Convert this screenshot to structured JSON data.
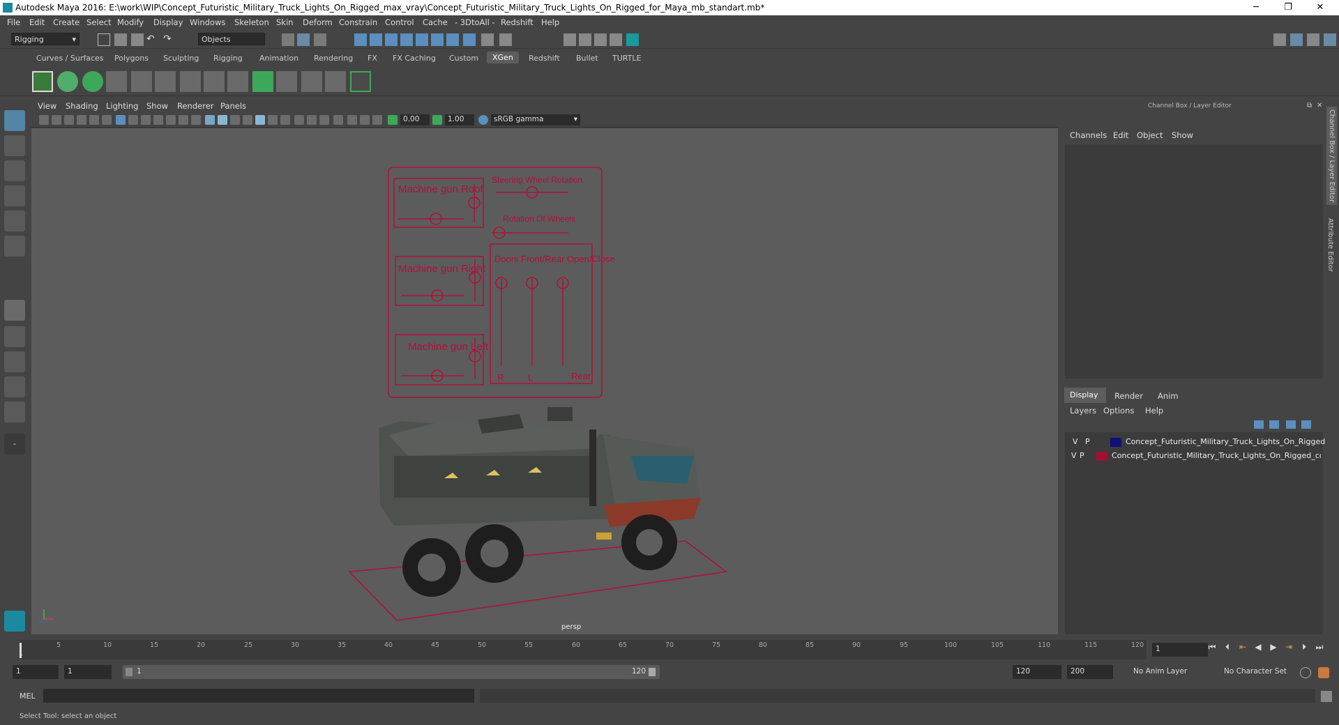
{
  "window": {
    "title": "Autodesk Maya 2016: E:\\work\\WIP\\Concept_Futuristic_Military_Truck_Lights_On_Rigged_max_vray\\Concept_Futuristic_Military_Truck_Lights_On_Rigged_for_Maya_mb_standart.mb*",
    "minimize": "─",
    "restore": "❐",
    "close": "✕"
  },
  "menubar": [
    "File",
    "Edit",
    "Create",
    "Select",
    "Modify",
    "Display",
    "Windows",
    "Skeleton",
    "Skin",
    "Deform",
    "Constrain",
    "Control",
    "Cache",
    "- 3DtoAll -",
    "Redshift",
    "Help"
  ],
  "statusline": {
    "mode": "Rigging",
    "selection_mask": "Objects"
  },
  "shelf_tabs": [
    "Curves / Surfaces",
    "Polygons",
    "Sculpting",
    "Rigging",
    "Animation",
    "Rendering",
    "FX",
    "FX Caching",
    "Custom",
    "XGen",
    "Redshift",
    "Bullet",
    "TURTLE"
  ],
  "shelf_active": "XGen",
  "viewport": {
    "menus": [
      "View",
      "Shading",
      "Lighting",
      "Show",
      "Renderer",
      "Panels"
    ],
    "exposure": "0.00",
    "gamma": "1.00",
    "color_space": "sRGB gamma",
    "camera_label": "persp"
  },
  "rig_panel": {
    "machine_gun_roof": "Machine gun Roof",
    "steering": "Steering Wheel Rotation",
    "rotation_wheels": "Rotation Of Wheels",
    "machine_gun_right": "Machine gun Right",
    "doors": "Doors Front/Rear Open/Close",
    "machine_gun_left": "Machine gun Left",
    "r": "R",
    "l": "L",
    "rear": "Rear"
  },
  "channelbox": {
    "title": "Channel Box / Layer Editor",
    "menus": [
      "Channels",
      "Edit",
      "Object",
      "Show"
    ],
    "layer_tabs": [
      "Display",
      "Render",
      "Anim"
    ],
    "layer_menus": [
      "Layers",
      "Options",
      "Help"
    ],
    "layers": [
      {
        "v": "V",
        "p": "P",
        "color": "#10107a",
        "name": "Concept_Futuristic_Military_Truck_Lights_On_Rigged"
      },
      {
        "v": "V",
        "p": "P",
        "color": "#a01030",
        "name": "Concept_Futuristic_Military_Truck_Lights_On_Rigged_coı"
      }
    ],
    "side_tabs": [
      "Channel Box / Layer Editor",
      "Attribute Editor"
    ]
  },
  "timeline": {
    "ticks": [
      "1",
      "5",
      "10",
      "15",
      "20",
      "25",
      "30",
      "35",
      "40",
      "45",
      "50",
      "55",
      "60",
      "65",
      "70",
      "75",
      "80",
      "85",
      "90",
      "95",
      "100",
      "105",
      "110",
      "115",
      "120"
    ],
    "current_frame": "1"
  },
  "range": {
    "start": "1",
    "current": "1",
    "slider_start": "1",
    "slider_end": "120",
    "end": "120",
    "max": "200",
    "anim_layer": "No Anim Layer",
    "char_set": "No Character Set"
  },
  "cmdline": {
    "label": "MEL"
  },
  "helpline": {
    "text": "Select Tool: select an object"
  }
}
